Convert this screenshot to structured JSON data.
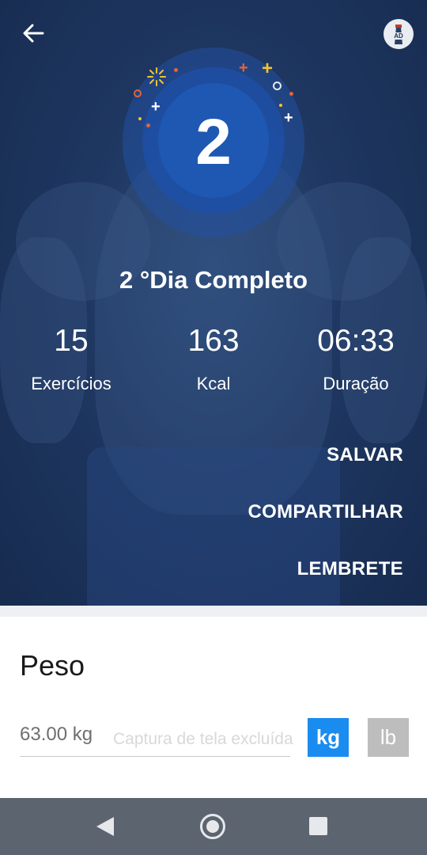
{
  "header": {
    "back_icon": "arrow-left-icon",
    "ad_icon": "ad-lighthouse-icon",
    "ad_label": "AD"
  },
  "badge": {
    "day_number": "2"
  },
  "summary": {
    "title": "2 °Dia Completo",
    "stats": [
      {
        "value": "15",
        "label": "Exercícios"
      },
      {
        "value": "163",
        "label": "Kcal"
      },
      {
        "value": "06:33",
        "label": "Duração"
      }
    ]
  },
  "actions": {
    "save": "SALVAR",
    "share": "COMPARTILHAR",
    "reminder": "LEMBRETE"
  },
  "weight": {
    "title": "Peso",
    "value": "63.00 kg",
    "capture_note": "Captura de tela excluída",
    "unit_kg": "kg",
    "unit_lb": "lb",
    "selected_unit": "kg"
  },
  "colors": {
    "hero_bg": "#1e3761",
    "badge_blue": "#1f58b2",
    "kg_active": "#1a8cf0",
    "lb_inactive": "#bdbdbd",
    "nav_bar": "#5c6470"
  },
  "navbar": {
    "back_icon": "triangle-back-icon",
    "home_icon": "circle-home-icon",
    "recents_icon": "square-recents-icon"
  }
}
